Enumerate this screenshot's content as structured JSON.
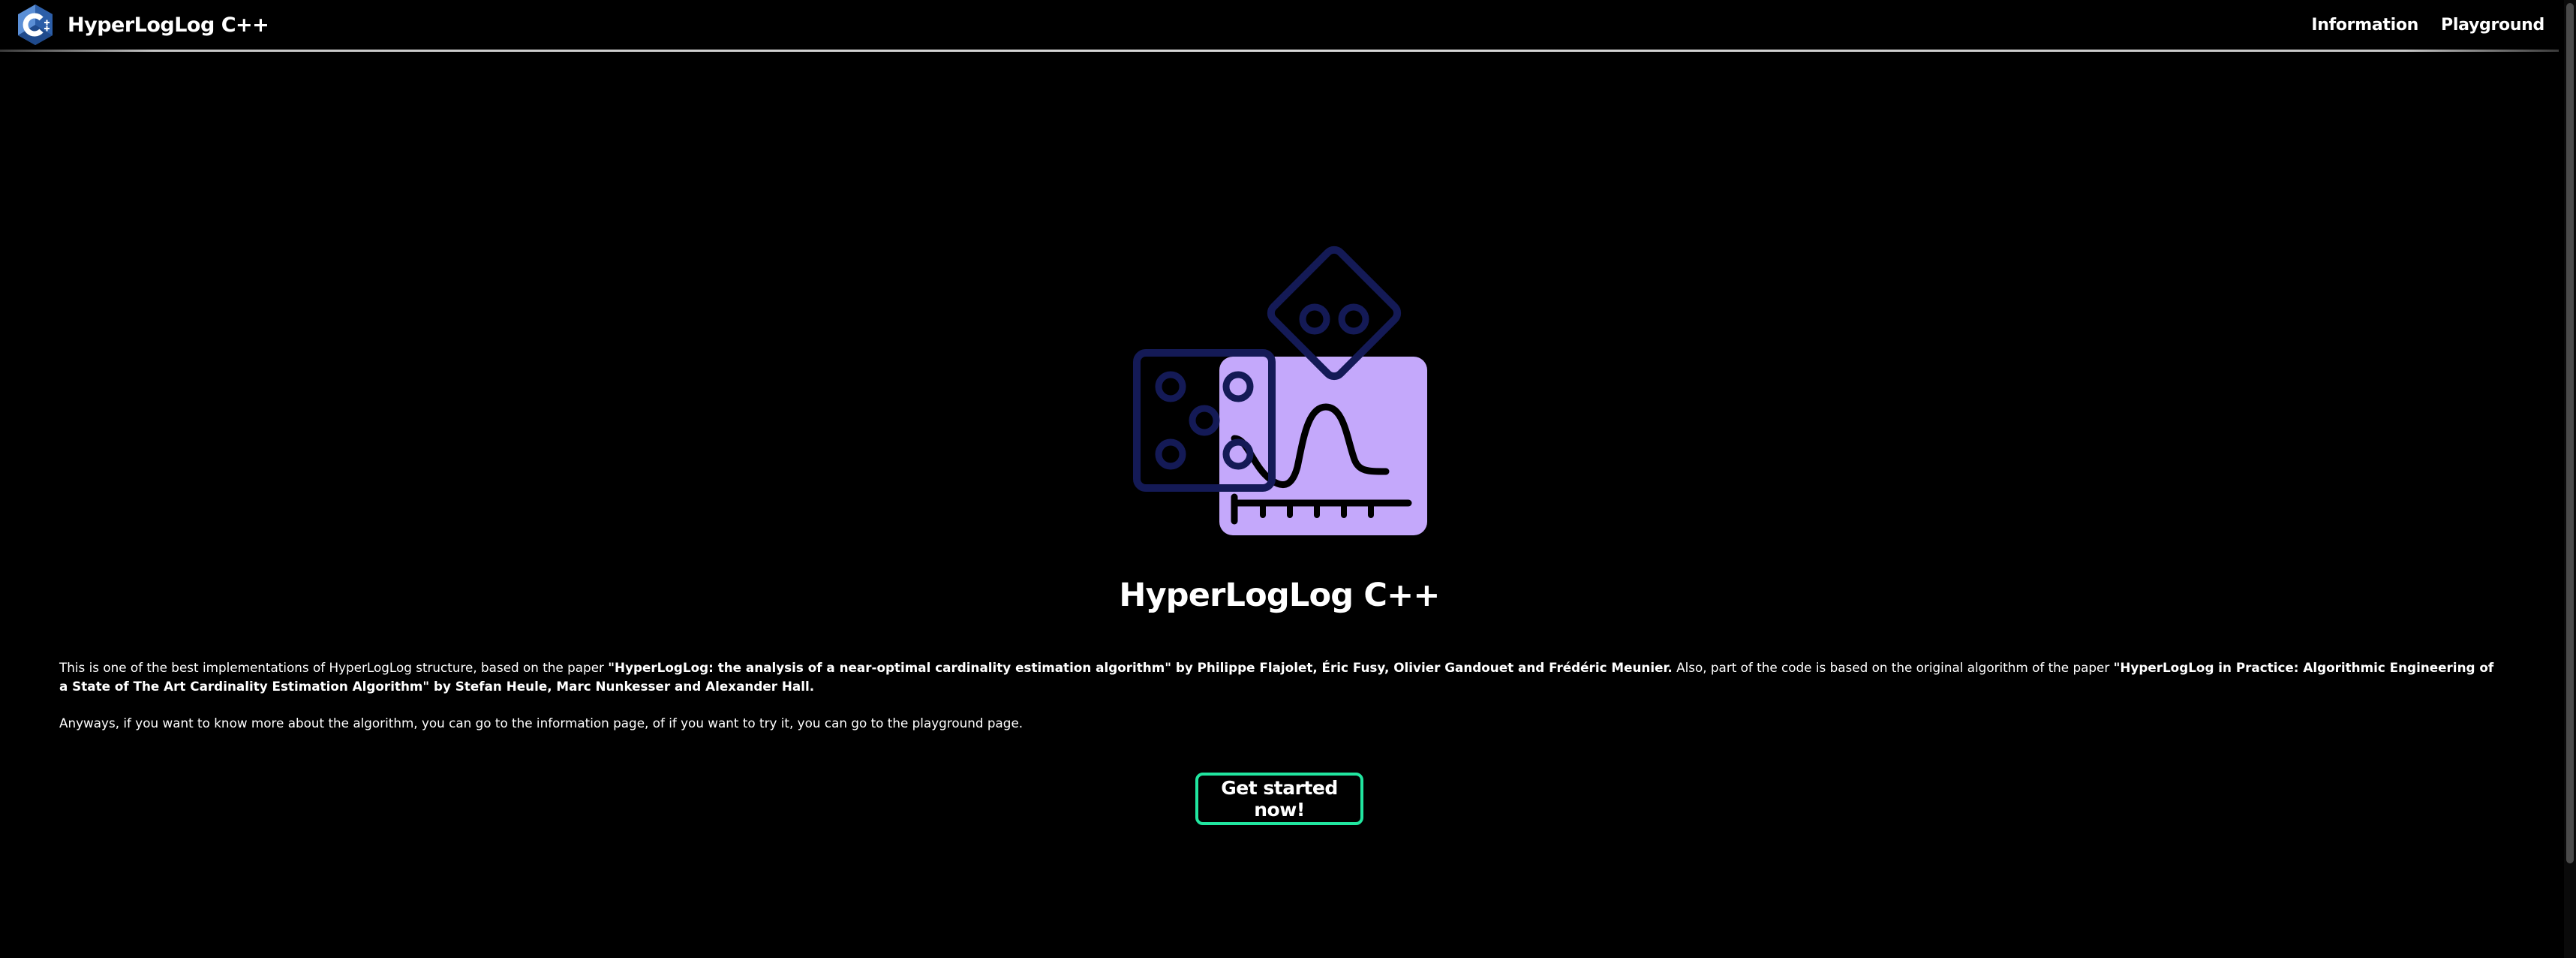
{
  "navbar": {
    "brand_name": "HyperLogLog C++",
    "brand_logo_icon": "cplusplus-logo-icon",
    "links": [
      {
        "label": "Information"
      },
      {
        "label": "Playground"
      }
    ]
  },
  "hero": {
    "illustration_icon": "dice-probability-graph-icon",
    "title": "HyperLogLog C++"
  },
  "description": {
    "p1_intro": "This is one of the best implementations of HyperLogLog structure, based on the paper ",
    "p1_paper1": "\"HyperLogLog: the analysis of a near-optimal cardinality estimation algorithm\" by Philippe Flajolet, Éric Fusy, Olivier Gandouet and Frédéric Meunier.",
    "p1_middle": " Also, part of the code is based on the original algorithm of the paper ",
    "p1_paper2": "\"HyperLogLog in Practice: Algorithmic Engineering of a State of The Art Cardinality Estimation Algorithm\" by Stefan Heule, Marc Nunkesser and Alexander Hall.",
    "p2": "Anyways, if you want to know more about the algorithm, you can go to the information page, of if you want to try it, you can go to the playground page."
  },
  "cta": {
    "label": "Get started now!"
  },
  "colors": {
    "background": "#000000",
    "text": "#ffffff",
    "accent_border": "#21e6a0",
    "illustration_navy": "#141a56",
    "illustration_lavender": "#c4a8fb",
    "illustration_dark": "#000000",
    "logo_blue": "#5b8fd6"
  }
}
